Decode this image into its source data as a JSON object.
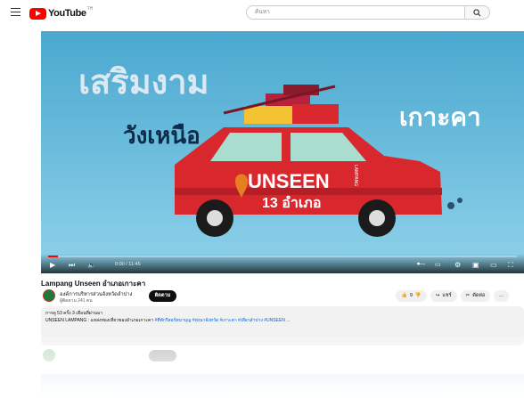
{
  "header": {
    "logo_text": "YouTube",
    "logo_country": "TH",
    "search_placeholder": "ค้นหา"
  },
  "video": {
    "art": {
      "headline": "เสริมงาม",
      "subheadline": "วังเหนือ",
      "right_text": "เกาะคา",
      "car_banner": "UNSEEN",
      "car_sub": "13 อำเภอ",
      "car_side": "LAMPANG"
    },
    "time": "0:00 / 11:45",
    "progress": 0.02
  },
  "info": {
    "title": "Lampang Unseen อำเภอเกาะคา",
    "channel_name": "องค์การบริหารส่วนจังหวัดลำปาง",
    "subscribers": "ผู้ติดตาม 241 คน",
    "subscribe_label": "ติดตาม",
    "like_count": "9",
    "share_label": "แชร์",
    "clip_label": "ตัดต่อ",
    "more_label": "..."
  },
  "description": {
    "meta": "การดู 53 ครั้ง  3 เดือนที่ผ่านมา",
    "text_plain": "UNSEEN LAMPANG : แหล่งท่องเที่ยวของอำเภอเกาะคา ",
    "text_links": "#ที่พักรีสอร์ทนาบุญ #ทุ่งนาจังหวัด #เกาะคา #เที่ยวลำปาง #UNSEEN ..."
  },
  "colors": {
    "brand_red": "#ff0000",
    "player_sky": "#5bb6d8",
    "car_red": "#d8282e"
  }
}
